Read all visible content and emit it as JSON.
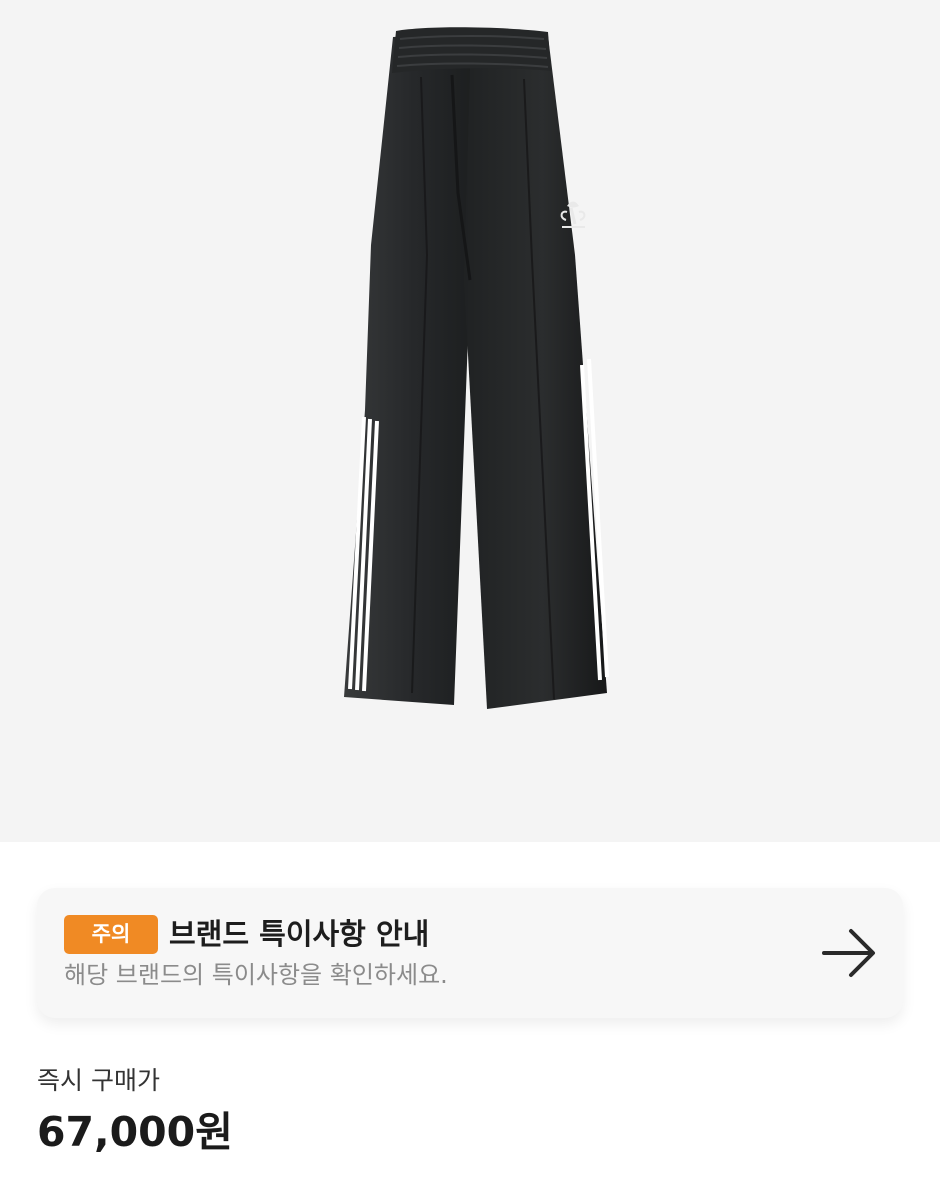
{
  "product": {
    "image": {
      "icon_name": "black-track-pants-image",
      "stripe_color": "#ffffff",
      "fabric_color": "#2b2b2b"
    }
  },
  "notice": {
    "badge": "주의",
    "title": "브랜드 특이사항 안내",
    "subtitle": "해당 브랜드의 특이사항을 확인하세요.",
    "arrow_icon": "arrow-right-icon",
    "badge_color": "#f08a24"
  },
  "price": {
    "label": "즉시 구매가",
    "value": "67,000원"
  }
}
